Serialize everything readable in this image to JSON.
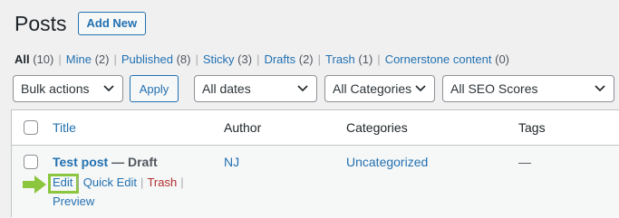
{
  "header": {
    "title": "Posts",
    "add_new_label": "Add New"
  },
  "views": [
    {
      "label": "All",
      "count": "(10)",
      "current": true
    },
    {
      "label": "Mine",
      "count": "(2)"
    },
    {
      "label": "Published",
      "count": "(8)"
    },
    {
      "label": "Sticky",
      "count": "(3)"
    },
    {
      "label": "Drafts",
      "count": "(2)"
    },
    {
      "label": "Trash",
      "count": "(1)"
    },
    {
      "label": "Cornerstone content",
      "count": "(0)"
    }
  ],
  "filters": {
    "bulk_actions": "Bulk actions",
    "apply_label": "Apply",
    "dates": "All dates",
    "categories": "All Categories",
    "seo": "All SEO Scores"
  },
  "table": {
    "columns": {
      "title": "Title",
      "author": "Author",
      "categories": "Categories",
      "tags": "Tags"
    },
    "rows": [
      {
        "title": "Test post",
        "state": " — Draft",
        "author": "NJ",
        "categories": "Uncategorized",
        "tags": "—",
        "actions": {
          "edit": "Edit",
          "quick_edit": "Quick Edit",
          "trash": "Trash",
          "preview": "Preview",
          "sep": "|"
        }
      }
    ]
  },
  "colors": {
    "accent": "#2271b1",
    "highlight": "#8cc63f",
    "danger": "#b32d2e"
  }
}
